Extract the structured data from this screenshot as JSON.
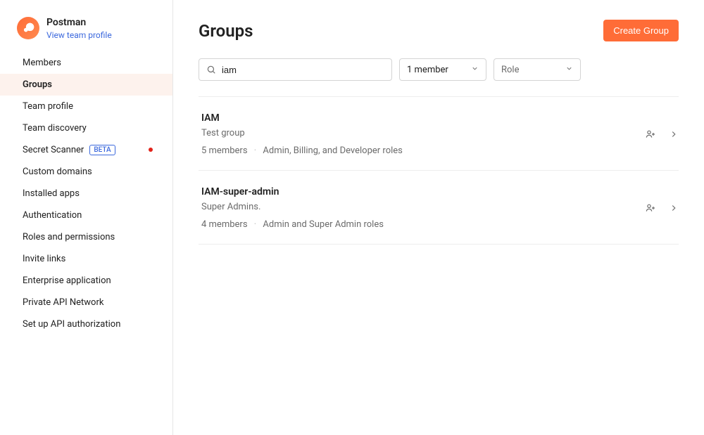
{
  "team": {
    "name": "Postman",
    "profile_link_label": "View team profile"
  },
  "sidebar": {
    "items": [
      {
        "label": "Members",
        "active": false
      },
      {
        "label": "Groups",
        "active": true
      },
      {
        "label": "Team profile",
        "active": false
      },
      {
        "label": "Team discovery",
        "active": false
      },
      {
        "label": "Secret Scanner",
        "active": false,
        "badge": "BETA",
        "has_dot": true
      },
      {
        "label": "Custom domains",
        "active": false
      },
      {
        "label": "Installed apps",
        "active": false
      },
      {
        "label": "Authentication",
        "active": false
      },
      {
        "label": "Roles and permissions",
        "active": false
      },
      {
        "label": "Invite links",
        "active": false
      },
      {
        "label": "Enterprise application",
        "active": false
      },
      {
        "label": "Private API Network",
        "active": false
      },
      {
        "label": "Set up API authorization",
        "active": false
      }
    ]
  },
  "header": {
    "title": "Groups",
    "create_button_label": "Create Group"
  },
  "filters": {
    "search_value": "iam",
    "member_select_value": "1 member",
    "role_select_placeholder": "Role"
  },
  "groups": [
    {
      "name": "IAM",
      "description": "Test group",
      "members_text": "5 members",
      "roles_text": "Admin, Billing, and Developer roles"
    },
    {
      "name": "IAM-super-admin",
      "description": "Super Admins.",
      "members_text": "4 members",
      "roles_text": "Admin and Super Admin roles"
    }
  ],
  "colors": {
    "accent": "#ff6c37",
    "link": "#3b68dd",
    "muted": "#6b6b6b"
  }
}
